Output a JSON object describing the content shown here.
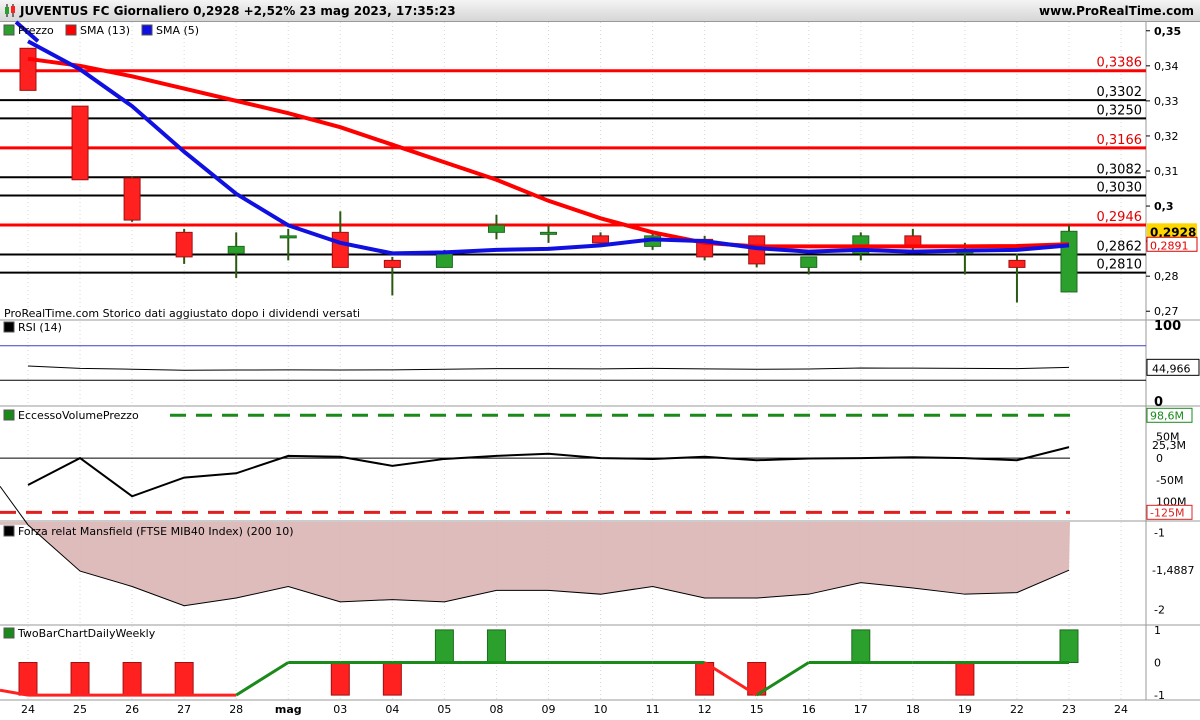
{
  "header": {
    "title": "JUVENTUS FC Giornaliero 0,2928 +2,52% 23 mag 2023, 17:35:23",
    "site": "www.ProRealTime.com"
  },
  "footer_note": "ProRealTime.com  Storico dati aggiustato dopo i dividendi versati",
  "legends": {
    "price": [
      "Prezzo",
      "SMA (13)",
      "SMA (5)"
    ],
    "rsi": "RSI (14)",
    "excess": "EccessoVolumePrezzo",
    "mansfield": "Forza relat Mansfield (FTSE MIB40 Index) (200 10)",
    "twobar": "TwoBarChartDailyWeekly"
  },
  "colors": {
    "up": "#2ca02c",
    "down": "#ff2020",
    "sma13": "#ff0000",
    "sma5": "#1010e0",
    "support": "#000000",
    "mansfield_fill": "#d9b0b0",
    "dash_green": "#1a8a1a",
    "dash_red": "#e02020",
    "last_price_bg": "#ffd700"
  },
  "chart_data": [
    {
      "type": "candlestick",
      "title": "JUVENTUS FC Giornaliero",
      "x": [
        "24",
        "25",
        "26",
        "27",
        "28",
        "02",
        "03",
        "04",
        "05",
        "08",
        "09",
        "10",
        "11",
        "12",
        "15",
        "16",
        "17",
        "18",
        "19",
        "22",
        "23"
      ],
      "x_tick_labels": [
        "24",
        "25",
        "26",
        "27",
        "28",
        "mag",
        "03",
        "04",
        "05",
        "08",
        "09",
        "10",
        "11",
        "12",
        "15",
        "16",
        "17",
        "18",
        "19",
        "22",
        "23",
        "24"
      ],
      "ohlc": [
        {
          "o": 0.345,
          "h": 0.345,
          "l": 0.333,
          "c": 0.333
        },
        {
          "o": 0.3285,
          "h": 0.3285,
          "l": 0.3075,
          "c": 0.3075
        },
        {
          "o": 0.308,
          "h": 0.3085,
          "l": 0.2955,
          "c": 0.296
        },
        {
          "o": 0.2925,
          "h": 0.2935,
          "l": 0.2835,
          "c": 0.2855
        },
        {
          "o": 0.2865,
          "h": 0.2925,
          "l": 0.2795,
          "c": 0.2885
        },
        {
          "o": 0.2915,
          "h": 0.2935,
          "l": 0.2845,
          "c": 0.2915
        },
        {
          "o": 0.2925,
          "h": 0.2985,
          "l": 0.2825,
          "c": 0.2825
        },
        {
          "o": 0.2845,
          "h": 0.2855,
          "l": 0.2745,
          "c": 0.2825
        },
        {
          "o": 0.2825,
          "h": 0.2875,
          "l": 0.2825,
          "c": 0.2865
        },
        {
          "o": 0.2925,
          "h": 0.2975,
          "l": 0.2905,
          "c": 0.2945
        },
        {
          "o": 0.2925,
          "h": 0.2945,
          "l": 0.2895,
          "c": 0.2925
        },
        {
          "o": 0.2915,
          "h": 0.2925,
          "l": 0.2885,
          "c": 0.2895
        },
        {
          "o": 0.2885,
          "h": 0.2925,
          "l": 0.2875,
          "c": 0.2915
        },
        {
          "o": 0.2905,
          "h": 0.2915,
          "l": 0.2845,
          "c": 0.2855
        },
        {
          "o": 0.2915,
          "h": 0.2915,
          "l": 0.2825,
          "c": 0.2835
        },
        {
          "o": 0.2825,
          "h": 0.2855,
          "l": 0.2805,
          "c": 0.2855
        },
        {
          "o": 0.2865,
          "h": 0.2925,
          "l": 0.2845,
          "c": 0.2915
        },
        {
          "o": 0.2915,
          "h": 0.2935,
          "l": 0.2875,
          "c": 0.2885
        },
        {
          "o": 0.2865,
          "h": 0.2895,
          "l": 0.2805,
          "c": 0.2875
        },
        {
          "o": 0.2845,
          "h": 0.2865,
          "l": 0.2725,
          "c": 0.2825
        },
        {
          "o": 0.2755,
          "h": 0.2945,
          "l": 0.2755,
          "c": 0.2928
        }
      ],
      "sma13": [
        0.342,
        0.34,
        0.337,
        0.3335,
        0.33,
        0.3265,
        0.3225,
        0.3175,
        0.3125,
        0.3075,
        0.3015,
        0.2965,
        0.2925,
        0.2895,
        0.2885,
        0.2885,
        0.2885,
        0.2885,
        0.2885,
        0.2886,
        0.2891
      ],
      "sma5": [
        0.347,
        0.339,
        0.3285,
        0.3155,
        0.3035,
        0.2945,
        0.2895,
        0.2865,
        0.2868,
        0.2875,
        0.2878,
        0.2888,
        0.2905,
        0.29,
        0.288,
        0.287,
        0.2875,
        0.287,
        0.2873,
        0.2875,
        0.2888
      ],
      "levels_red": [
        0.3386,
        0.3166,
        0.2946
      ],
      "levels_black": [
        0.3302,
        0.325,
        0.3082,
        0.303,
        0.2862,
        0.281
      ],
      "level_labels_red": [
        "0,3386",
        "0,3166",
        "0,2946"
      ],
      "level_labels_black": [
        "0,3302",
        "0,3250",
        "0,3082",
        "0,3030",
        "0,2862",
        "0,2810"
      ],
      "last_price": 0.2928,
      "last_price_label": "0,2928",
      "sma13_last_label": "0,2891",
      "ylim": [
        0.2675,
        0.3525
      ],
      "y_ticks": [
        0.27,
        0.28,
        0.29,
        0.3,
        0.31,
        0.32,
        0.33,
        0.34,
        0.35
      ],
      "y_tick_labels": [
        "0,27",
        "0,28",
        "0,29",
        "0,3",
        "0,31",
        "0,32",
        "0,33",
        "0,34",
        "0,35"
      ]
    },
    {
      "type": "line",
      "title": "RSI (14)",
      "values": [
        46.5,
        43.8,
        42.8,
        41.5,
        41.8,
        42.0,
        41.8,
        42.0,
        42.8,
        43.5,
        43.4,
        43.2,
        43.8,
        43.1,
        42.7,
        43.0,
        44.2,
        44.0,
        43.8,
        43.4,
        44.966
      ],
      "ylim": [
        0,
        100
      ],
      "y_ticks": [
        0,
        100
      ],
      "y_tick_labels": [
        "0",
        "100"
      ],
      "band_line": 70,
      "lower_band_line": 30,
      "last_label": "44,966"
    },
    {
      "type": "line",
      "title": "EccessoVolumePrezzo",
      "values": [
        -62,
        0,
        -88,
        -45,
        -35,
        5,
        3,
        -18,
        -2,
        5,
        10,
        0,
        -2,
        3,
        -5,
        -1,
        0,
        2,
        0,
        -5,
        25.3
      ],
      "unit": "M",
      "ylim": [
        -145,
        120
      ],
      "y_ticks": [
        -100,
        -50,
        0,
        50
      ],
      "y_tick_labels": [
        "100M",
        "-50M",
        "0",
        "50M"
      ],
      "upper_dashed": 98.6,
      "lower_dashed": -125,
      "upper_label": "98,6M",
      "lower_label": "-125M",
      "last_label": "25,3M"
    },
    {
      "type": "area",
      "title": "Forza relat Mansfield (FTSE MIB40 Index) (200 10)",
      "values": [
        -0.9,
        -1.5,
        -1.7,
        -1.95,
        -1.85,
        -1.7,
        -1.9,
        -1.87,
        -1.9,
        -1.75,
        -1.75,
        -1.8,
        -1.7,
        -1.85,
        -1.85,
        -1.8,
        -1.65,
        -1.72,
        -1.8,
        -1.78,
        -1.4887
      ],
      "ylim": [
        -2.2,
        -0.85
      ],
      "y_ticks": [
        -1,
        -2
      ],
      "y_tick_labels": [
        "-1",
        "-2"
      ],
      "last_label": "-1,4887"
    },
    {
      "type": "bar",
      "title": "TwoBarChartDailyWeekly",
      "values": [
        -1,
        -1,
        -1,
        -1,
        0,
        0,
        -1,
        -1,
        1,
        1,
        0,
        0,
        0,
        -1,
        -1,
        0,
        1,
        0,
        -1,
        0,
        1
      ],
      "line": [
        -1,
        -1,
        -1,
        -1,
        -1,
        0,
        0,
        0,
        0,
        0,
        0,
        0,
        0,
        0,
        -1,
        0,
        0,
        0,
        0,
        0,
        0
      ],
      "ylim": [
        -1.15,
        1.15
      ],
      "y_ticks": [
        -1,
        0,
        1
      ],
      "y_tick_labels": [
        "-1",
        "0",
        "1"
      ]
    }
  ]
}
